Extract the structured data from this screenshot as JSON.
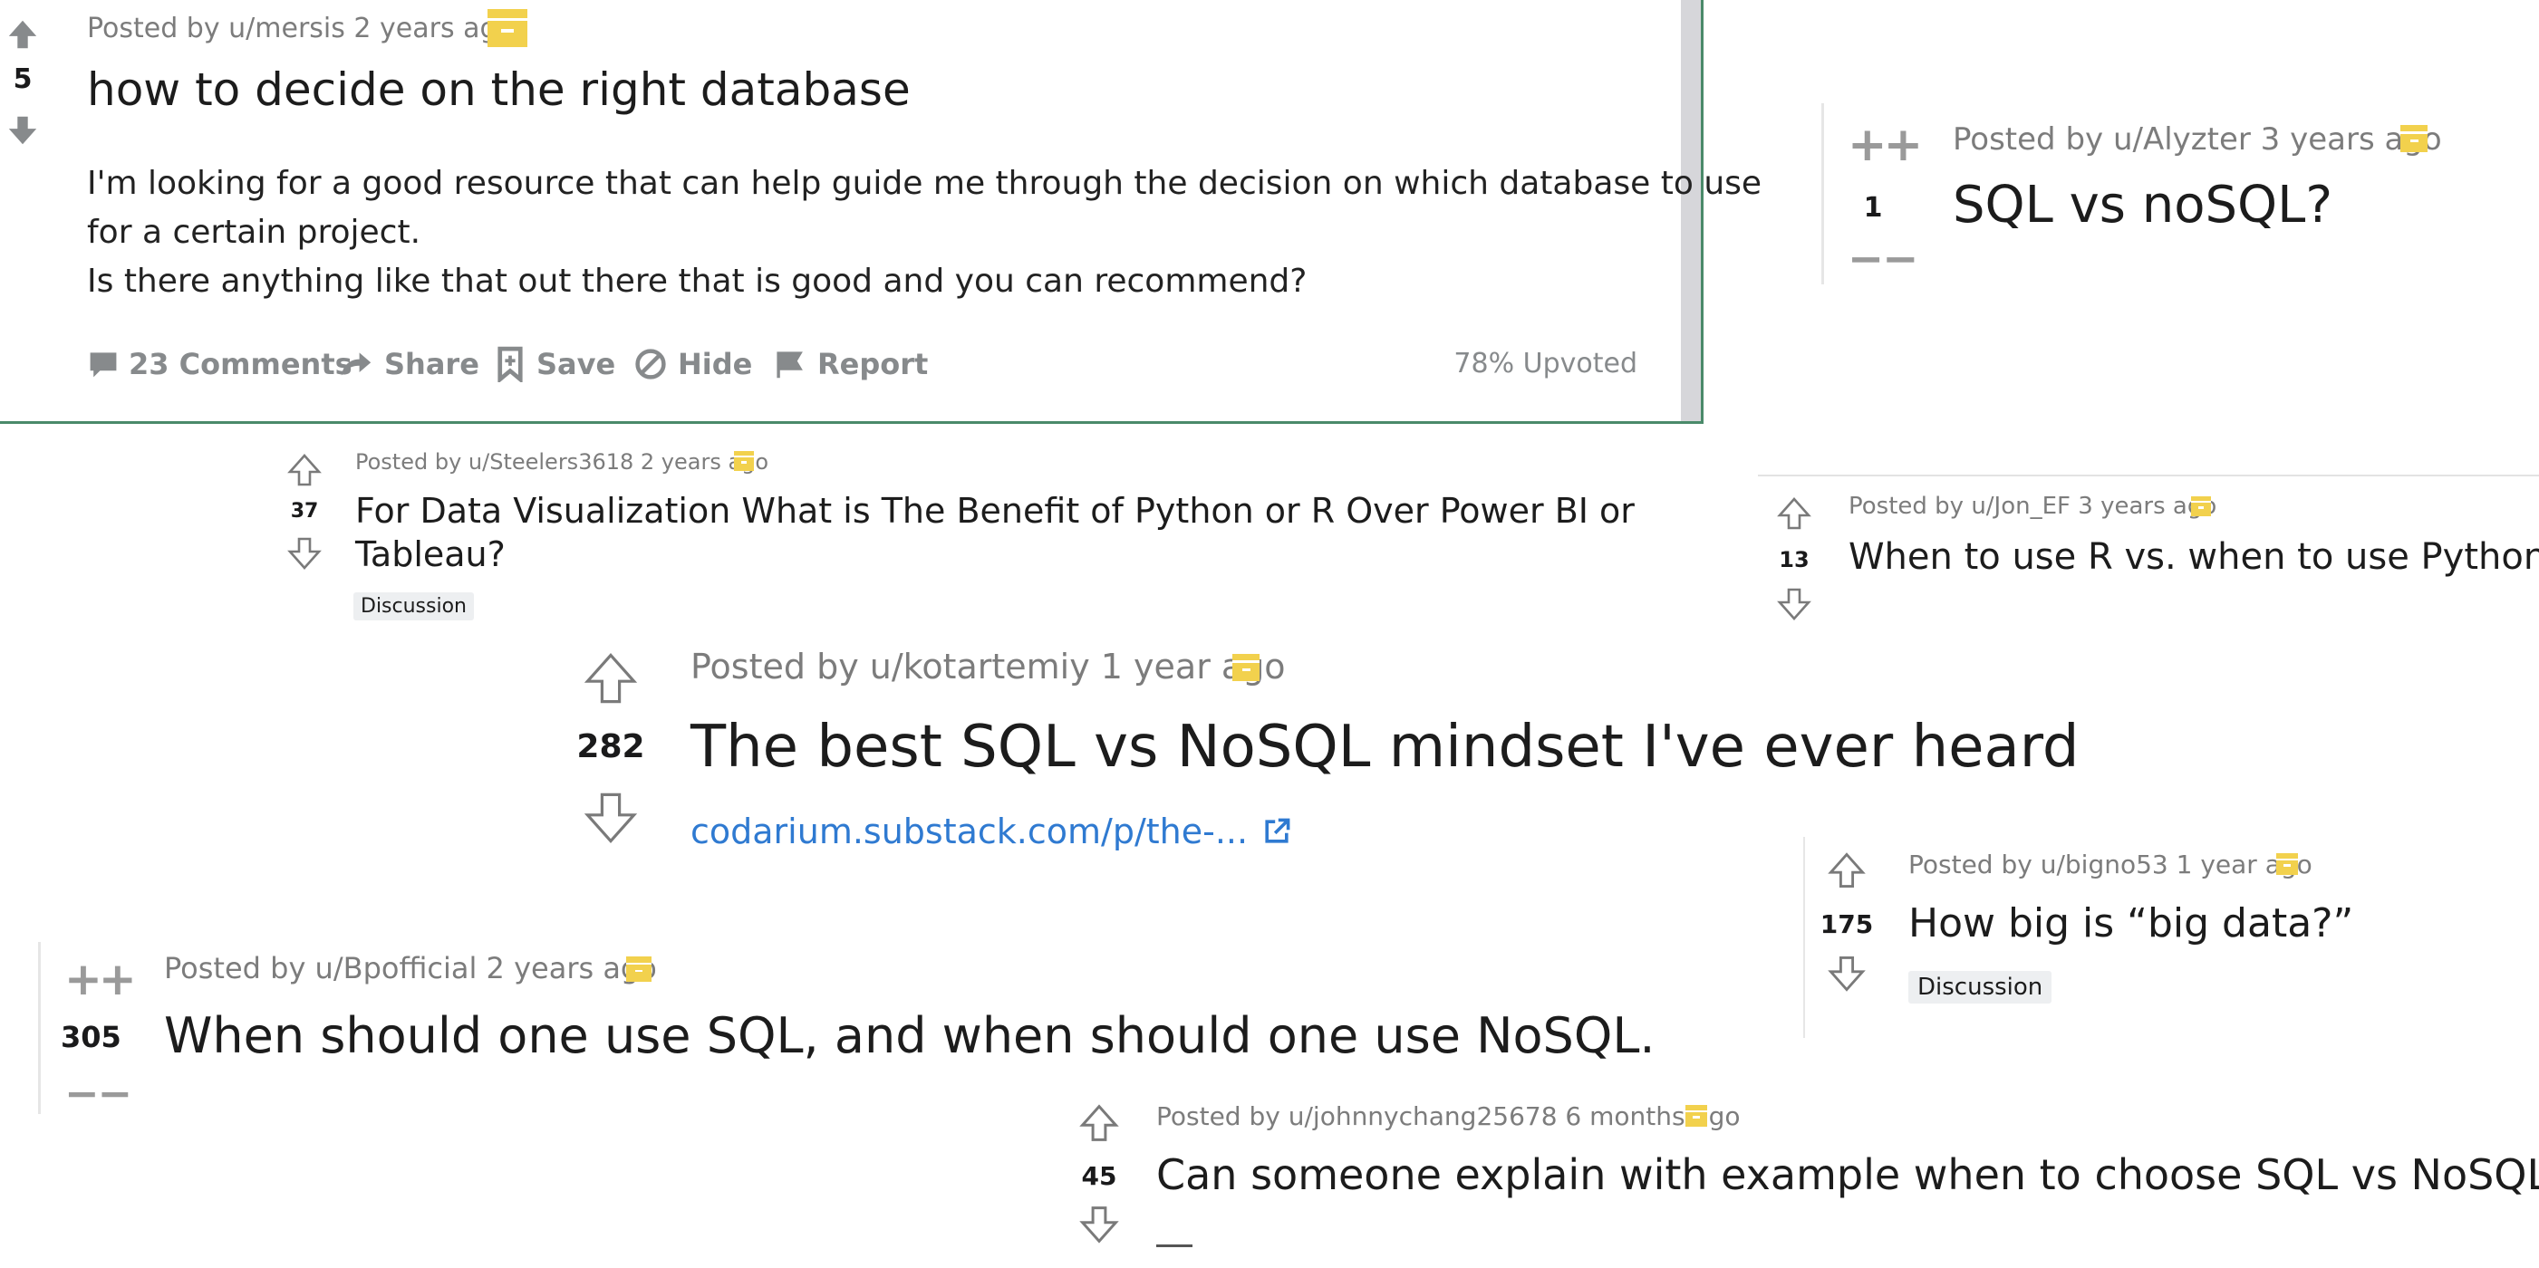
{
  "posts": {
    "p1": {
      "meta": "Posted by u/mersis 2 years ago",
      "score": "5",
      "title": "how to decide on the right database",
      "body_line1": "I'm looking for a good resource that can help guide me through the decision on which database to use",
      "body_line2": "for a certain project.",
      "body_line3": "Is there anything like that out there that is good and you can recommend?",
      "comments": "23 Comments",
      "share": "Share",
      "save": "Save",
      "hide": "Hide",
      "report": "Report",
      "upvoted": "78% Upvoted"
    },
    "p2": {
      "meta": "Posted by u/Alyzter 3 years ago",
      "score": "1",
      "title": "SQL vs noSQL?",
      "up_glyph": "++",
      "down_glyph": "−−"
    },
    "p3": {
      "meta": "Posted by u/Steelers3618 2 years ago",
      "score": "37",
      "title_line1": "For Data Visualization What is The Benefit of Python or R Over Power BI or",
      "title_line2": "Tableau?",
      "flair": "Discussion"
    },
    "p4": {
      "meta": "Posted by u/Jon_EF 3 years ago",
      "score": "13",
      "title": "When to use R vs. when to use Python?"
    },
    "p5": {
      "meta": "Posted by u/kotartemiy 1 year ago",
      "score": "282",
      "title": "The best SQL vs NoSQL mindset I've ever heard",
      "link": "codarium.substack.com/p/the-..."
    },
    "p6": {
      "meta": "Posted by u/bigno53 1 year ago",
      "score": "175",
      "title": "How big is “big data?”",
      "flair": "Discussion"
    },
    "p7": {
      "meta": "Posted by u/Bpofficial 2 years ago",
      "score": "305",
      "title": "When should one use SQL, and when should one use NoSQL.",
      "up_glyph": "++",
      "down_glyph": "−−"
    },
    "p8": {
      "meta": "Posted by u/johnnychang25678 6 months ago",
      "score": "45",
      "title": "Can someone explain with example when to choose SQL vs NoSQL?"
    }
  },
  "icons": [
    "upvote-arrow-icon",
    "downvote-arrow-icon",
    "archived-box-icon",
    "comment-icon",
    "share-icon",
    "save-bookmark-icon",
    "hide-icon",
    "report-flag-icon",
    "external-link-icon"
  ],
  "colors": {
    "archived": "#f2d14d",
    "link": "#2f7ad1",
    "meta": "#7c7c7c",
    "upvote_filled": "#878a8c"
  }
}
